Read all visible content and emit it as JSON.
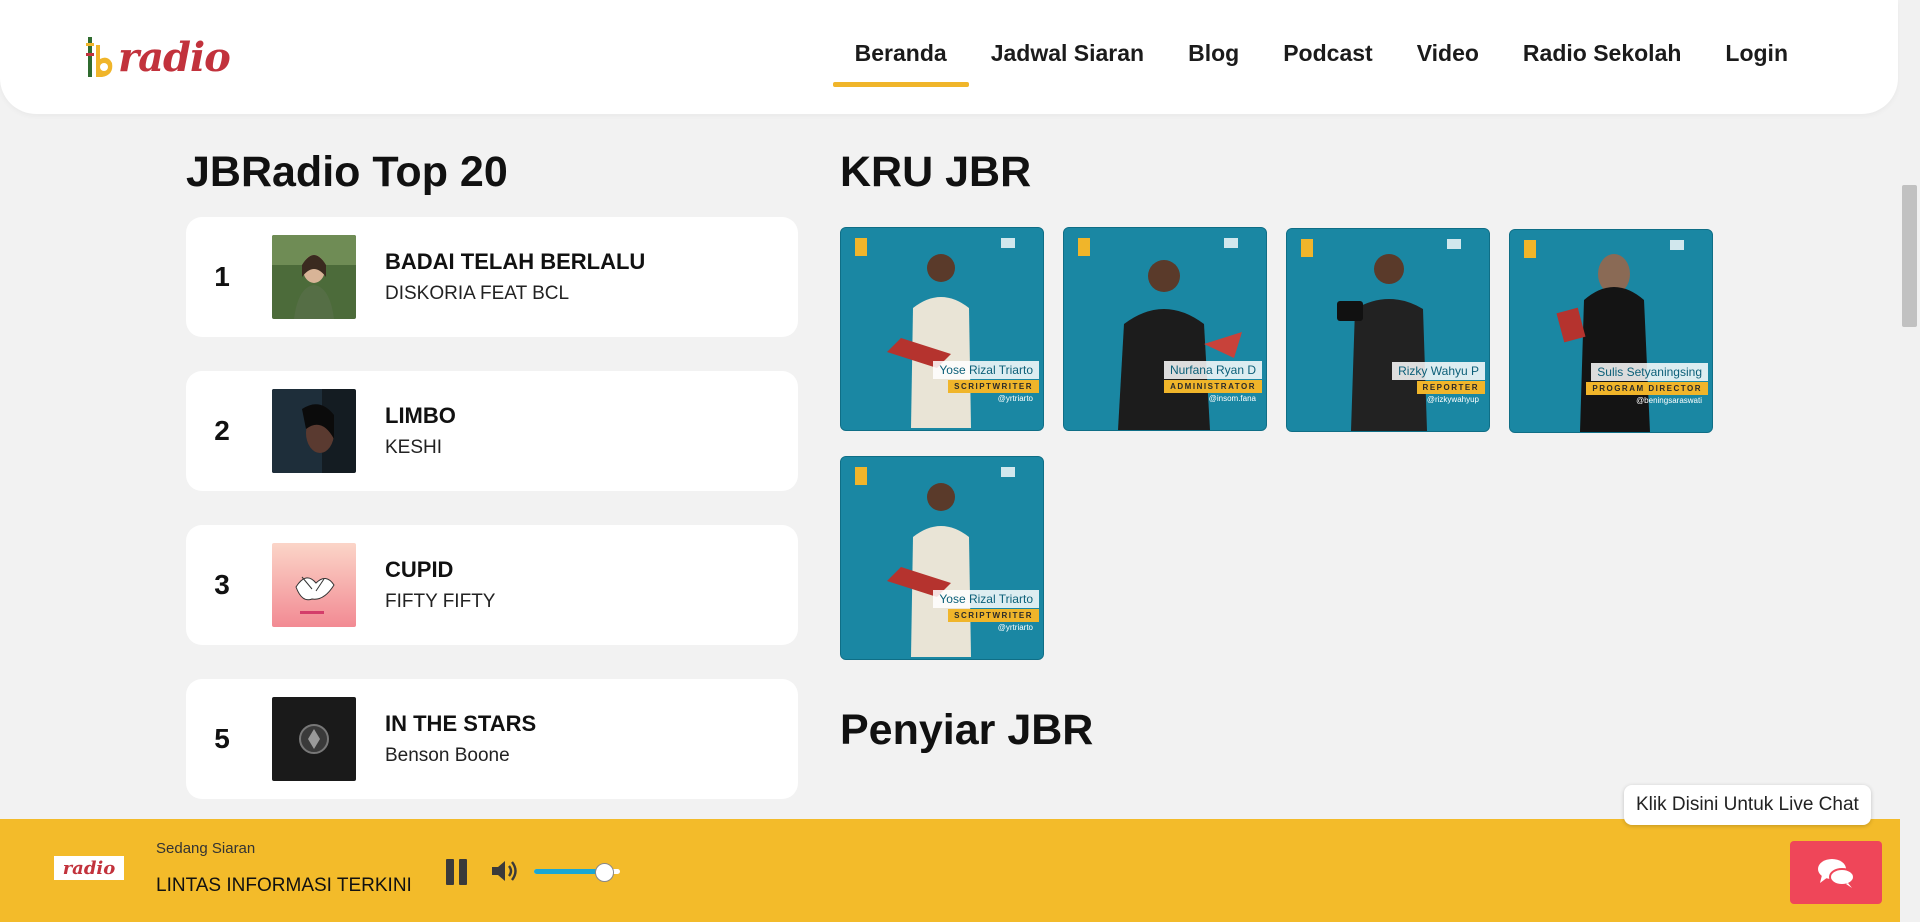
{
  "header": {
    "logo_text": "radio",
    "nav": [
      {
        "label": "Beranda",
        "active": true
      },
      {
        "label": "Jadwal Siaran",
        "active": false
      },
      {
        "label": "Blog",
        "active": false
      },
      {
        "label": "Podcast",
        "active": false
      },
      {
        "label": "Video",
        "active": false
      },
      {
        "label": "Radio Sekolah",
        "active": false
      },
      {
        "label": "Login",
        "active": false
      }
    ]
  },
  "top20": {
    "title": "JBRadio Top 20",
    "songs": [
      {
        "rank": "1",
        "title": "BADAI TELAH BERLALU",
        "artist": "DISKORIA FEAT BCL"
      },
      {
        "rank": "2",
        "title": "LIMBO",
        "artist": "KESHI"
      },
      {
        "rank": "3",
        "title": "CUPID",
        "artist": "FIFTY FIFTY"
      },
      {
        "rank": "5",
        "title": "IN THE STARS",
        "artist": "Benson Boone"
      }
    ]
  },
  "crew": {
    "title": "KRU JBR",
    "members": [
      {
        "name": "Yose Rizal Triarto",
        "role": "SCRIPTWRITER",
        "handle": "@yrtriarto"
      },
      {
        "name": "Nurfana Ryan D",
        "role": "ADMINISTRATOR",
        "handle": "@insom.fana"
      },
      {
        "name": "Rizky Wahyu P",
        "role": "REPORTER",
        "handle": "@rizkywahyup"
      },
      {
        "name": "Sulis Setyaningsing",
        "role": "PROGRAM DIRECTOR",
        "handle": "@beningsaraswati"
      },
      {
        "name": "Yose Rizal Triarto",
        "role": "SCRIPTWRITER",
        "handle": "@yrtriarto"
      }
    ]
  },
  "announcers": {
    "title": "Penyiar JBR"
  },
  "player": {
    "logo_text": "radio",
    "now_label": "Sedang Siaran",
    "now_title": "LINTAS INFORMASI TERKINI",
    "volume_fraction": 0.8
  },
  "chat": {
    "tooltip": "Klik Disini Untuk Live Chat"
  },
  "colors": {
    "accent": "#f3bb2a",
    "brand_red": "#c2323c",
    "crew_bg": "#1a87a3",
    "chat_btn": "#ef4659"
  }
}
